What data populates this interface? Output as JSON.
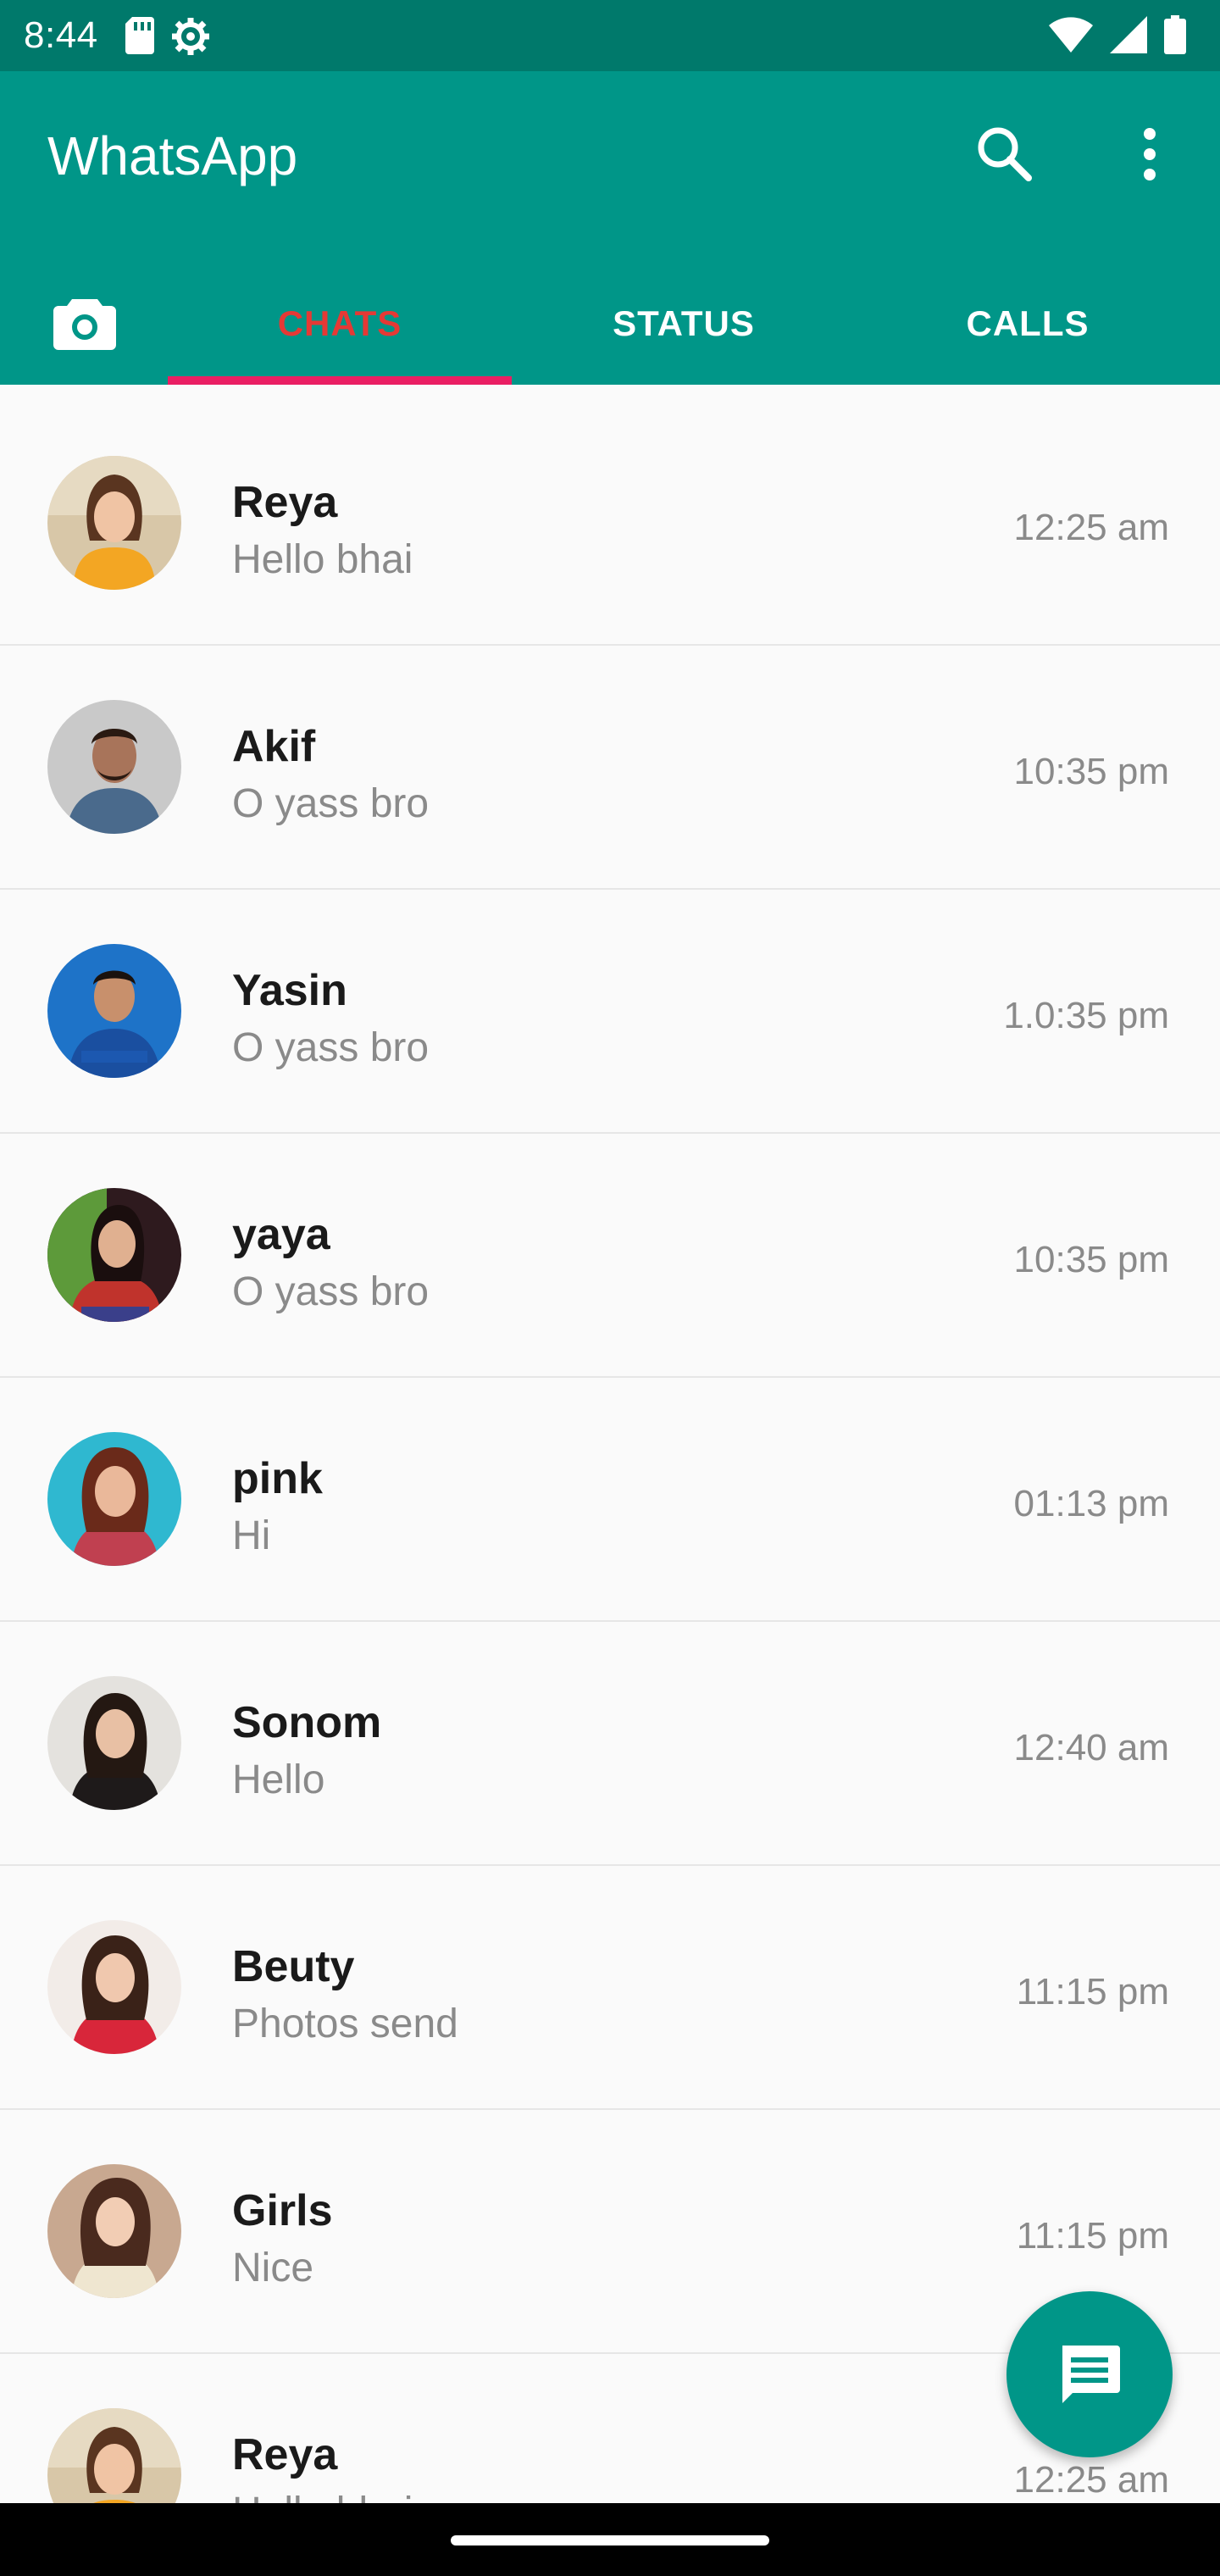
{
  "status_bar": {
    "time": "8:44",
    "left_icons": [
      "sd-card-icon",
      "settings-gear-icon"
    ],
    "right_icons": [
      "wifi-icon",
      "signal-icon",
      "battery-icon"
    ]
  },
  "app_bar": {
    "title": "WhatsApp",
    "actions": [
      "search-icon",
      "more-vert-icon"
    ]
  },
  "tabs": {
    "camera_icon": "camera-icon",
    "items": [
      {
        "label": "CHATS",
        "selected": true
      },
      {
        "label": "STATUS",
        "selected": false
      },
      {
        "label": "CALLS",
        "selected": false
      }
    ],
    "selected_color": "#e53935",
    "indicator_color": "#e91e63"
  },
  "chats": [
    {
      "name": "Reya",
      "preview": "Hello bhai",
      "time": "12:25 am"
    },
    {
      "name": "Akif",
      "preview": "O yass bro",
      "time": "10:35 pm"
    },
    {
      "name": "Yasin",
      "preview": "O yass bro",
      "time": "1.0:35 pm"
    },
    {
      "name": "yaya",
      "preview": "O yass bro",
      "time": "10:35 pm"
    },
    {
      "name": "pink",
      "preview": "Hi",
      "time": "01:13 pm"
    },
    {
      "name": "Sonom",
      "preview": "Hello",
      "time": "12:40 am"
    },
    {
      "name": "Beuty",
      "preview": "Photos send",
      "time": "11:15 pm"
    },
    {
      "name": "Girls",
      "preview": "Nice",
      "time": "11:15 pm"
    },
    {
      "name": "Reya",
      "preview": "Hello bhai",
      "time": "12:25 am"
    }
  ],
  "fab": {
    "icon": "message-icon"
  },
  "colors": {
    "status_bar": "#00796b",
    "app_bar": "#009688",
    "background": "#fafafa"
  }
}
